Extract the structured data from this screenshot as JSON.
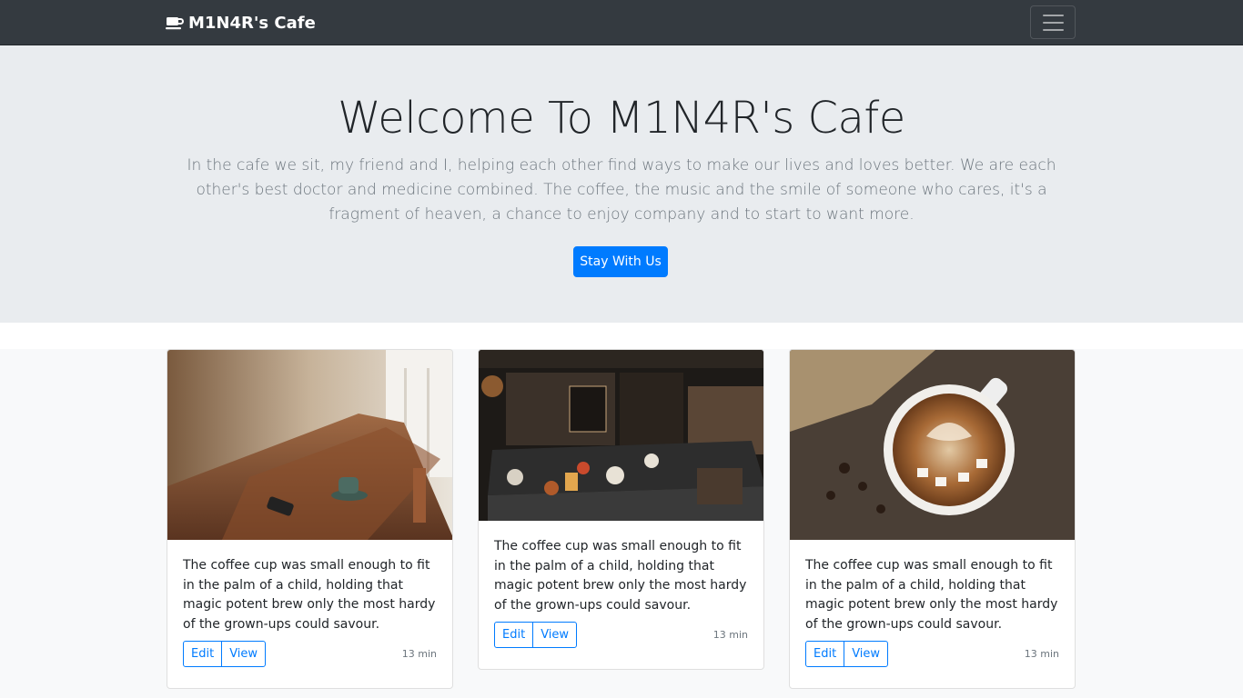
{
  "navbar": {
    "brand": "M1N4R's Cafe",
    "brand_icon": "coffee-cup-icon",
    "toggler_icon": "hamburger-menu-icon"
  },
  "hero": {
    "title": "Welcome To M1N4R's Cafe",
    "lead": "In the cafe we sit, my friend and I, helping each other find ways to make our lives and loves better. We are each other's best doctor and medicine combined. The coffee, the music and the smile of someone who cares, it's a fragment of heaven, a chance to enjoy company and to start to want more.",
    "cta": "Stay With Us"
  },
  "cards": [
    {
      "image": "cafe-interior-wooden-table-photo",
      "text": "The coffee cup was small enough to fit in the palm of a child, holding that magic potent brew only the most hardy of the grown-ups could savour.",
      "edit": "Edit",
      "view": "View",
      "time": "13 min"
    },
    {
      "image": "cafe-counter-bar-photo",
      "text": "The coffee cup was small enough to fit in the palm of a child, holding that magic potent brew only the most hardy of the grown-ups could savour.",
      "edit": "Edit",
      "view": "View",
      "time": "13 min"
    },
    {
      "image": "latte-art-coffee-cup-photo",
      "text": "The coffee cup was small enough to fit in the palm of a child, holding that magic potent brew only the most hardy of the grown-ups could savour.",
      "edit": "Edit",
      "view": "View",
      "time": "13 min"
    }
  ]
}
